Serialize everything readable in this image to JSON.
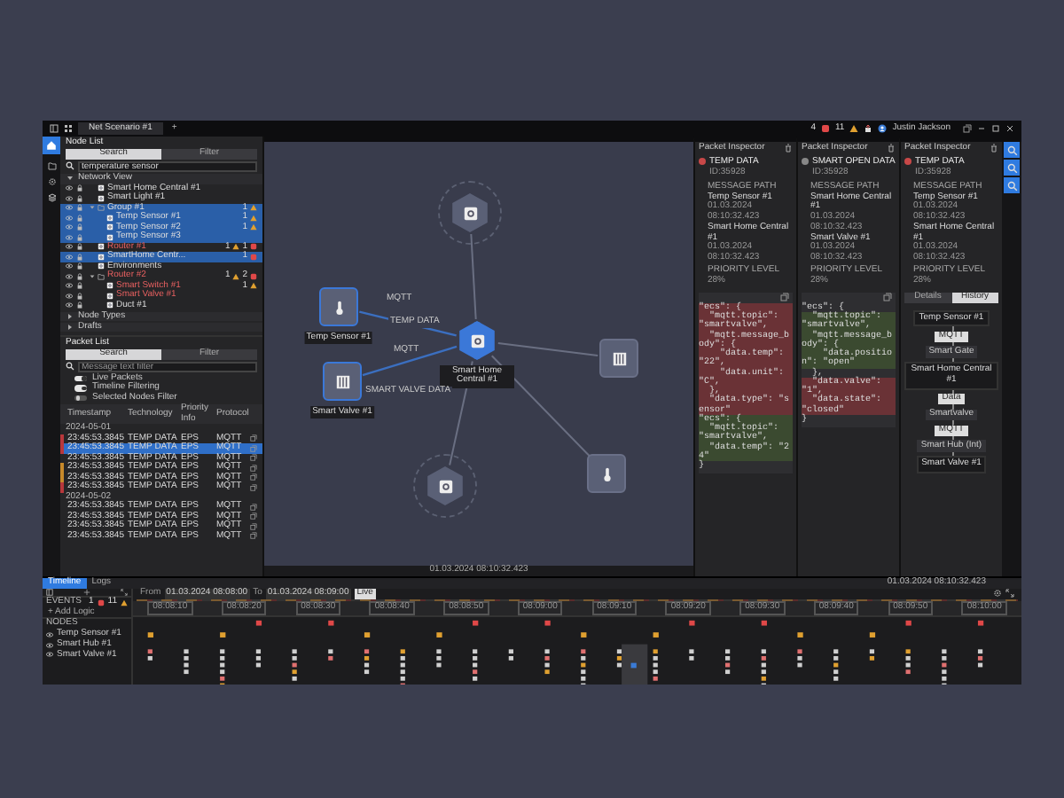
{
  "window": {
    "tab_title": "Net Scenario #1",
    "new_tab": "+",
    "errors": "4",
    "warnings": "11",
    "user": "Justin Jackson"
  },
  "node_list": {
    "title": "Node List",
    "tabs": [
      {
        "label": "Search",
        "selected": true
      },
      {
        "label": "Filter",
        "selected": false
      }
    ],
    "search_value": "temperature sensor",
    "section": "Network View",
    "items": [
      {
        "name": "Smart Home Central #1",
        "selected": false,
        "alert": false
      },
      {
        "name": "Smart Light #1",
        "selected": false,
        "alert": false
      },
      {
        "name": "Group #1",
        "selected": true,
        "alert": false,
        "warnings": "1",
        "children": [
          {
            "name": "Temp Sensor #1",
            "selected": true,
            "alert": false,
            "warnings": "1"
          },
          {
            "name": "Temp Sensor #2",
            "selected": true,
            "alert": false,
            "warnings": "1"
          },
          {
            "name": "Temp Sensor #3",
            "selected": true,
            "alert": false
          }
        ]
      },
      {
        "name": "Router #1",
        "selected": false,
        "alert": true,
        "warnings": "1",
        "errors": "1"
      },
      {
        "name": "SmartHome Centr...",
        "selected": true,
        "alert": false,
        "errors": "1"
      },
      {
        "name": "Environments",
        "selected": false,
        "alert": false
      },
      {
        "name": "Router #2",
        "selected": false,
        "alert": true,
        "warnings": "1",
        "errors": "2",
        "children": [
          {
            "name": "Smart Switch #1",
            "selected": false,
            "alert": true,
            "warnings": "1"
          },
          {
            "name": "Smart Valve #1",
            "selected": false,
            "alert": true
          },
          {
            "name": "Duct #1",
            "selected": false,
            "alert": false
          }
        ]
      }
    ],
    "groups": [
      "Node Types",
      "Drafts"
    ]
  },
  "packet_list": {
    "title": "Packet List",
    "tabs": [
      {
        "label": "Search",
        "selected": true
      },
      {
        "label": "Filter",
        "selected": false
      }
    ],
    "placeholder": "Message text filter",
    "toggles": [
      {
        "label": "Live Packets",
        "on": true
      },
      {
        "label": "Timeline Filtering",
        "on": true
      },
      {
        "label": "Selected Nodes Filter",
        "on": false
      }
    ],
    "columns": [
      "Timestamp",
      "Technology",
      "Priority Info",
      "Protocol"
    ],
    "groups": [
      {
        "date": "2024-05-01",
        "rows": [
          {
            "time": "23:45:53.3845",
            "type": "TEMP DATA",
            "info": "EPS",
            "protocol": "MQTT",
            "selected": false,
            "color": "#b8383c"
          },
          {
            "time": "23:45:53.3845",
            "type": "TEMP DATA",
            "info": "EPS",
            "protocol": "MQTT",
            "selected": true,
            "color": "#b8383c"
          },
          {
            "time": "23:45:53.3845",
            "type": "TEMP DATA",
            "info": "EPS",
            "protocol": "MQTT",
            "selected": false
          },
          {
            "time": "23:45:53.3845",
            "type": "TEMP DATA",
            "info": "EPS",
            "protocol": "MQTT",
            "selected": false,
            "color": "#c7892a"
          },
          {
            "time": "23:45:53.3845",
            "type": "TEMP DATA",
            "info": "EPS",
            "protocol": "MQTT",
            "selected": false,
            "color": "#c7892a"
          },
          {
            "time": "23:45:53.3845",
            "type": "TEMP DATA",
            "info": "EPS",
            "protocol": "MQTT",
            "selected": false,
            "color": "#b8383c"
          }
        ]
      },
      {
        "date": "2024-05-02",
        "rows": [
          {
            "time": "23:45:53.3845",
            "type": "TEMP DATA",
            "info": "EPS",
            "protocol": "MQTT",
            "selected": false
          },
          {
            "time": "23:45:53.3845",
            "type": "TEMP DATA",
            "info": "EPS",
            "protocol": "MQTT",
            "selected": false
          },
          {
            "time": "23:45:53.3845",
            "type": "TEMP DATA",
            "info": "EPS",
            "protocol": "MQTT",
            "selected": false
          },
          {
            "time": "23:45:53.3845",
            "type": "TEMP DATA",
            "info": "EPS",
            "protocol": "MQTT",
            "selected": false
          }
        ]
      }
    ]
  },
  "canvas": {
    "nodes": [
      {
        "kind": "hub",
        "selected": false
      },
      {
        "kind": "hub",
        "label": "Smart Home Central #1",
        "selected": true
      },
      {
        "kind": "sensor",
        "label": "Temp Sensor #1",
        "selected": true
      },
      {
        "kind": "valve",
        "label": "Smart Valve #1",
        "selected": true
      },
      {
        "kind": "valve",
        "selected": false
      },
      {
        "kind": "sensor",
        "selected": false
      },
      {
        "kind": "hub",
        "selected": false
      }
    ],
    "edge_labels": [
      "MQTT",
      "TEMP DATA",
      "MQTT",
      "SMART VALVE DATA"
    ],
    "timestamp": "01.03.2024 08:10:32.423"
  },
  "inspectors": [
    {
      "title": "Packet Inspector",
      "packet": "TEMP DATA",
      "id": "ID:35928",
      "error": true,
      "path_title": "MESSAGE PATH",
      "from": "Temp Sensor #1",
      "from_time": "01.03.2024 08:10:32.423",
      "to": "Smart Home Central #1",
      "to_time": "01.03.2024 08:10:32.423",
      "priority_title": "PRIORITY LEVEL",
      "priority": "28%",
      "code": [
        {
          "kind": "removed",
          "text": "\"ecs\": {"
        },
        {
          "kind": "removed",
          "text": "  \"mqtt.topic\": \"smartvalve\","
        },
        {
          "kind": "removed",
          "text": "  \"mqtt.message_body\": {"
        },
        {
          "kind": "removed",
          "text": "    \"data.temp\": \"22\","
        },
        {
          "kind": "removed",
          "text": "    \"data.unit\": \"C\","
        },
        {
          "kind": "removed",
          "text": "  },"
        },
        {
          "kind": "removed",
          "text": "  \"data.type\": \"sensor\""
        },
        {
          "kind": "added",
          "text": "\"ecs\": {"
        },
        {
          "kind": "added",
          "text": "  \"mqtt.topic\": \"smartvalve\","
        },
        {
          "kind": "added",
          "text": "  \"data.temp\": \"24\""
        },
        {
          "kind": "context",
          "text": "}"
        }
      ]
    },
    {
      "title": "Packet Inspector",
      "packet": "SMART OPEN DATA",
      "id": "ID:35928",
      "error": false,
      "path_title": "MESSAGE PATH",
      "from": "Smart Home Central #1",
      "from_time": "01.03.2024 08:10:32.423",
      "to": "Smart Valve #1",
      "to_time": "01.03.2024 08:10:32.423",
      "priority_title": "PRIORITY LEVEL",
      "priority": "28%",
      "code": [
        {
          "kind": "context",
          "text": "\"ecs\": {"
        },
        {
          "kind": "added",
          "text": "  \"mqtt.topic\": \"smartvalve\","
        },
        {
          "kind": "added",
          "text": "  \"mqtt.message_body\": {"
        },
        {
          "kind": "added",
          "text": "    \"data.position\": \"open\""
        },
        {
          "kind": "context",
          "text": "  },"
        },
        {
          "kind": "removed",
          "text": "  \"data.valve\": \"1\","
        },
        {
          "kind": "removed",
          "text": "  \"data.state\": \"closed\""
        },
        {
          "kind": "context",
          "text": "}"
        }
      ]
    },
    {
      "title": "Packet Inspector",
      "packet": "TEMP DATA",
      "id": "ID:35928",
      "error": true,
      "path_title": "MESSAGE PATH",
      "from": "Temp Sensor #1",
      "from_time": "01.03.2024 08:10:32.423",
      "to": "Smart Home Central #1",
      "to_time": "01.03.2024 08:10:32.423",
      "priority_title": "PRIORITY LEVEL",
      "priority": "28%",
      "tabs": [
        {
          "label": "Details",
          "selected": false
        },
        {
          "label": "History",
          "selected": true
        }
      ],
      "flow": [
        {
          "kind": "node",
          "text": "Temp Sensor #1"
        },
        {
          "kind": "tag",
          "text": "MQTT"
        },
        {
          "kind": "step",
          "text": "Smart Gate"
        },
        {
          "kind": "node",
          "text": "Smart Home Central #1"
        },
        {
          "kind": "tag",
          "text": "Data"
        },
        {
          "kind": "step",
          "text": "Smartvalve"
        },
        {
          "kind": "tag",
          "text": "MQTT"
        },
        {
          "kind": "step",
          "text": "Smart Hub (Int)"
        },
        {
          "kind": "node",
          "text": "Smart Valve #1"
        }
      ]
    }
  ],
  "timeline": {
    "tabs": [
      {
        "label": "Timeline",
        "selected": true
      },
      {
        "label": "Logs",
        "selected": false
      }
    ],
    "time": "01.03.2024 08:10:32.423",
    "from_label": "From",
    "from": "01.03.2024 08:08:00",
    "to_label": "To",
    "to": "01.03.2024 08:09:00",
    "live": "Live",
    "ticks": [
      "08:08:10",
      "08:08:20",
      "08:08:30",
      "08:08:40",
      "08:08:50",
      "08:09:00",
      "08:09:10",
      "08:09:20",
      "08:09:30",
      "08:09:40",
      "08:09:50",
      "08:10:00"
    ],
    "events_title": "EVENTS",
    "events_errors": "1",
    "events_warnings": "11",
    "add_logic": "+ Add Logic",
    "nodes_title": "NODES",
    "nodes": [
      "Temp Sensor #1",
      "Smart Hub #1",
      "Smart Valve #1"
    ]
  }
}
